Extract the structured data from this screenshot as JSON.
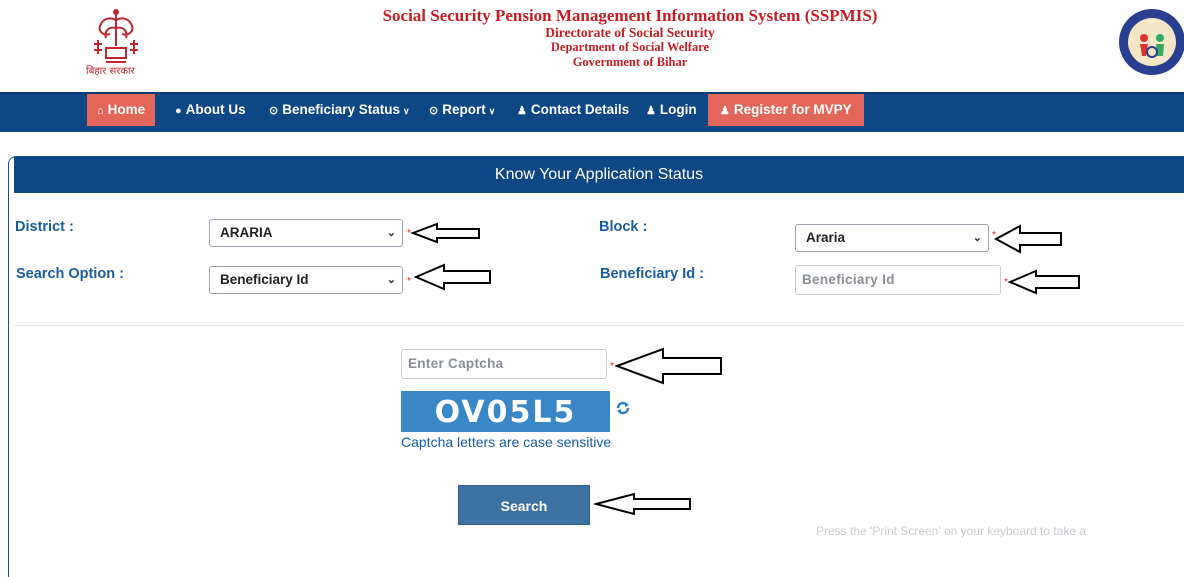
{
  "header": {
    "left_logo_caption": "बिहार सरकार",
    "title": "Social Security Pension Management Information System (SSPMIS)",
    "line2": "Directorate of Social Security",
    "line3": "Department of Social Welfare",
    "line4": "Government of Bihar"
  },
  "nav": {
    "home": "Home",
    "about": "About Us",
    "beneficiary_status": "Beneficiary Status",
    "report": "Report",
    "contact": "Contact Details",
    "login": "Login",
    "register": "Register for MVPY"
  },
  "panel": {
    "title": "Know Your Application Status"
  },
  "form": {
    "district_label": "District   :",
    "district_value": "ARARIA",
    "block_label": "Block   :",
    "block_value": "Araria",
    "search_option_label": "Search Option   :",
    "search_option_value": "Beneficiary Id",
    "beneficiary_id_label": "Beneficiary Id :",
    "beneficiary_id_placeholder": "Beneficiary Id",
    "captcha_placeholder": "Enter Captcha",
    "captcha_code": "OV05L5",
    "captcha_hint": "Captcha letters are case sensitive",
    "required_mark": "*",
    "search_button": "Search"
  },
  "overlay_text": "Press the 'Print Screen' on your keyboard to take a",
  "colors": {
    "title_red": "#c41e24",
    "nav_blue": "#0d4785",
    "nav_active": "#e2665a",
    "label_blue": "#1a5ca0",
    "button_blue": "#3c73a3"
  }
}
